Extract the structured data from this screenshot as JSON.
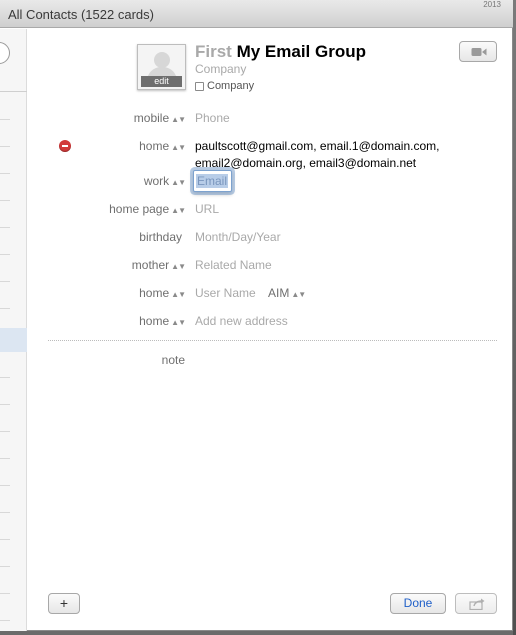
{
  "window": {
    "title": "All Contacts (1522 cards)",
    "corner_text": "2013"
  },
  "card": {
    "avatar_edit_label": "edit",
    "first_name_placeholder": "First",
    "last_name": "My Email Group",
    "company_placeholder": "Company",
    "company_checkbox_label": "Company"
  },
  "fields": [
    {
      "label": "mobile",
      "value": "Phone",
      "placeholder": true
    },
    {
      "label": "home",
      "value_line1": "paultscott@gmail.com, email.1@domain.com,",
      "value_line2": "email2@domain.org, email3@domain.net",
      "placeholder": false
    },
    {
      "label": "work",
      "value": "Email",
      "placeholder": true,
      "focused": true
    },
    {
      "label": "home page",
      "value": "URL",
      "placeholder": true
    },
    {
      "label": "birthday",
      "value": "Month/Day/Year",
      "placeholder": true
    },
    {
      "label": "mother",
      "value": "Related Name",
      "placeholder": true
    },
    {
      "label": "home",
      "value": "User Name",
      "service": "AIM",
      "placeholder": true
    },
    {
      "label": "home",
      "value": "Add new address",
      "placeholder": true
    }
  ],
  "note_label": "note",
  "footer": {
    "add_label": "+",
    "done_label": "Done"
  },
  "icons": {
    "video": "video-camera-icon",
    "share": "share-icon",
    "remove": "remove-field-icon",
    "avatar": "person-silhouette-icon"
  },
  "colors": {
    "accent": "#1f5fc8",
    "remove": "#d23a3a",
    "placeholder": "#a9a9a9",
    "label": "#6f6f6f"
  }
}
